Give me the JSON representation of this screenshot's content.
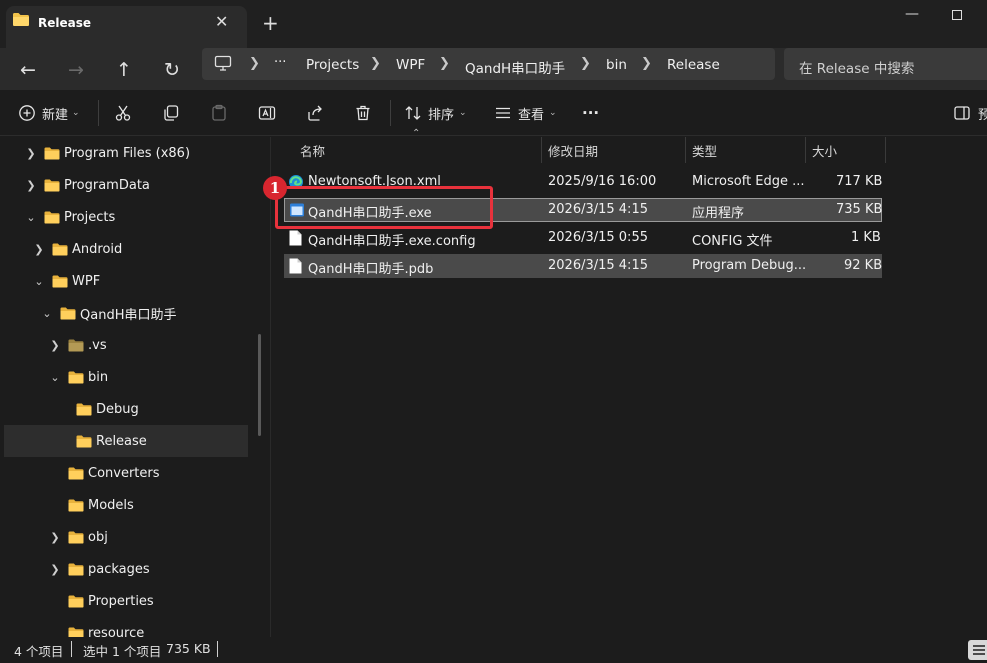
{
  "window": {
    "tab_title": "Release",
    "tab_close": "✕",
    "new_tab": "+",
    "minimize": "—",
    "maximize": ""
  },
  "nav": {
    "back": "←",
    "forward": "→",
    "up": "↑",
    "refresh": "↻",
    "breadcrumb": [
      {
        "label": "···"
      },
      {
        "label": "Projects"
      },
      {
        "label": "WPF"
      },
      {
        "label": "QandH串口助手"
      },
      {
        "label": "bin"
      },
      {
        "label": "Release"
      }
    ],
    "search_placeholder": "在 Release 中搜索"
  },
  "toolbar": {
    "new_label": "新建",
    "sort_label": "排序",
    "view_label": "查看",
    "more_label": "···",
    "preview_label": "预"
  },
  "sidebar": {
    "items": [
      {
        "label": "Program Files (x86)",
        "chevron": "❯",
        "icon": "folder"
      },
      {
        "label": "ProgramData",
        "chevron": "❯",
        "icon": "folder"
      },
      {
        "label": "Projects",
        "chevron": "⌄",
        "icon": "folder"
      },
      {
        "label": "Android",
        "chevron": "❯",
        "icon": "folder"
      },
      {
        "label": "WPF",
        "chevron": "⌄",
        "icon": "folder"
      },
      {
        "label": "QandH串口助手",
        "chevron": "⌄",
        "icon": "folder"
      },
      {
        "label": ".vs",
        "chevron": "❯",
        "icon": "folder-dim"
      },
      {
        "label": "bin",
        "chevron": "⌄",
        "icon": "folder"
      },
      {
        "label": "Debug",
        "chevron": "",
        "icon": "folder"
      },
      {
        "label": "Release",
        "chevron": "",
        "icon": "folder"
      },
      {
        "label": "Converters",
        "chevron": "",
        "icon": "folder"
      },
      {
        "label": "Models",
        "chevron": "",
        "icon": "folder"
      },
      {
        "label": "obj",
        "chevron": "❯",
        "icon": "folder"
      },
      {
        "label": "packages",
        "chevron": "❯",
        "icon": "folder"
      },
      {
        "label": "Properties",
        "chevron": "",
        "icon": "folder"
      },
      {
        "label": "resource",
        "chevron": "",
        "icon": "folder"
      }
    ]
  },
  "files": {
    "columns": {
      "name": "名称",
      "modified": "修改日期",
      "type": "类型",
      "size": "大小"
    },
    "rows": [
      {
        "name": "Newtonsoft.Json.xml",
        "modified": "2025/9/16 16:00",
        "type": "Microsoft Edge ...",
        "size": "717 KB",
        "icon": "edge-icon"
      },
      {
        "name": "QandH串口助手.exe",
        "modified": "2026/3/15 4:15",
        "type": "应用程序",
        "size": "735 KB",
        "icon": "app-icon"
      },
      {
        "name": "QandH串口助手.exe.config",
        "modified": "2026/3/15 0:55",
        "type": "CONFIG 文件",
        "size": "1 KB",
        "icon": "file-icon"
      },
      {
        "name": "QandH串口助手.pdb",
        "modified": "2026/3/15 4:15",
        "type": "Program Debug...",
        "size": "92 KB",
        "icon": "file-icon"
      }
    ]
  },
  "annotation": {
    "badge": "1",
    "color": "#e8323c"
  },
  "status": {
    "item_count": "4 个项目",
    "selected": "选中 1 个项目",
    "selected_size": "735 KB"
  },
  "colors": {
    "accent": "#4cc2ff",
    "folder": "#f2c34b",
    "selection": "#4a4a4a"
  }
}
